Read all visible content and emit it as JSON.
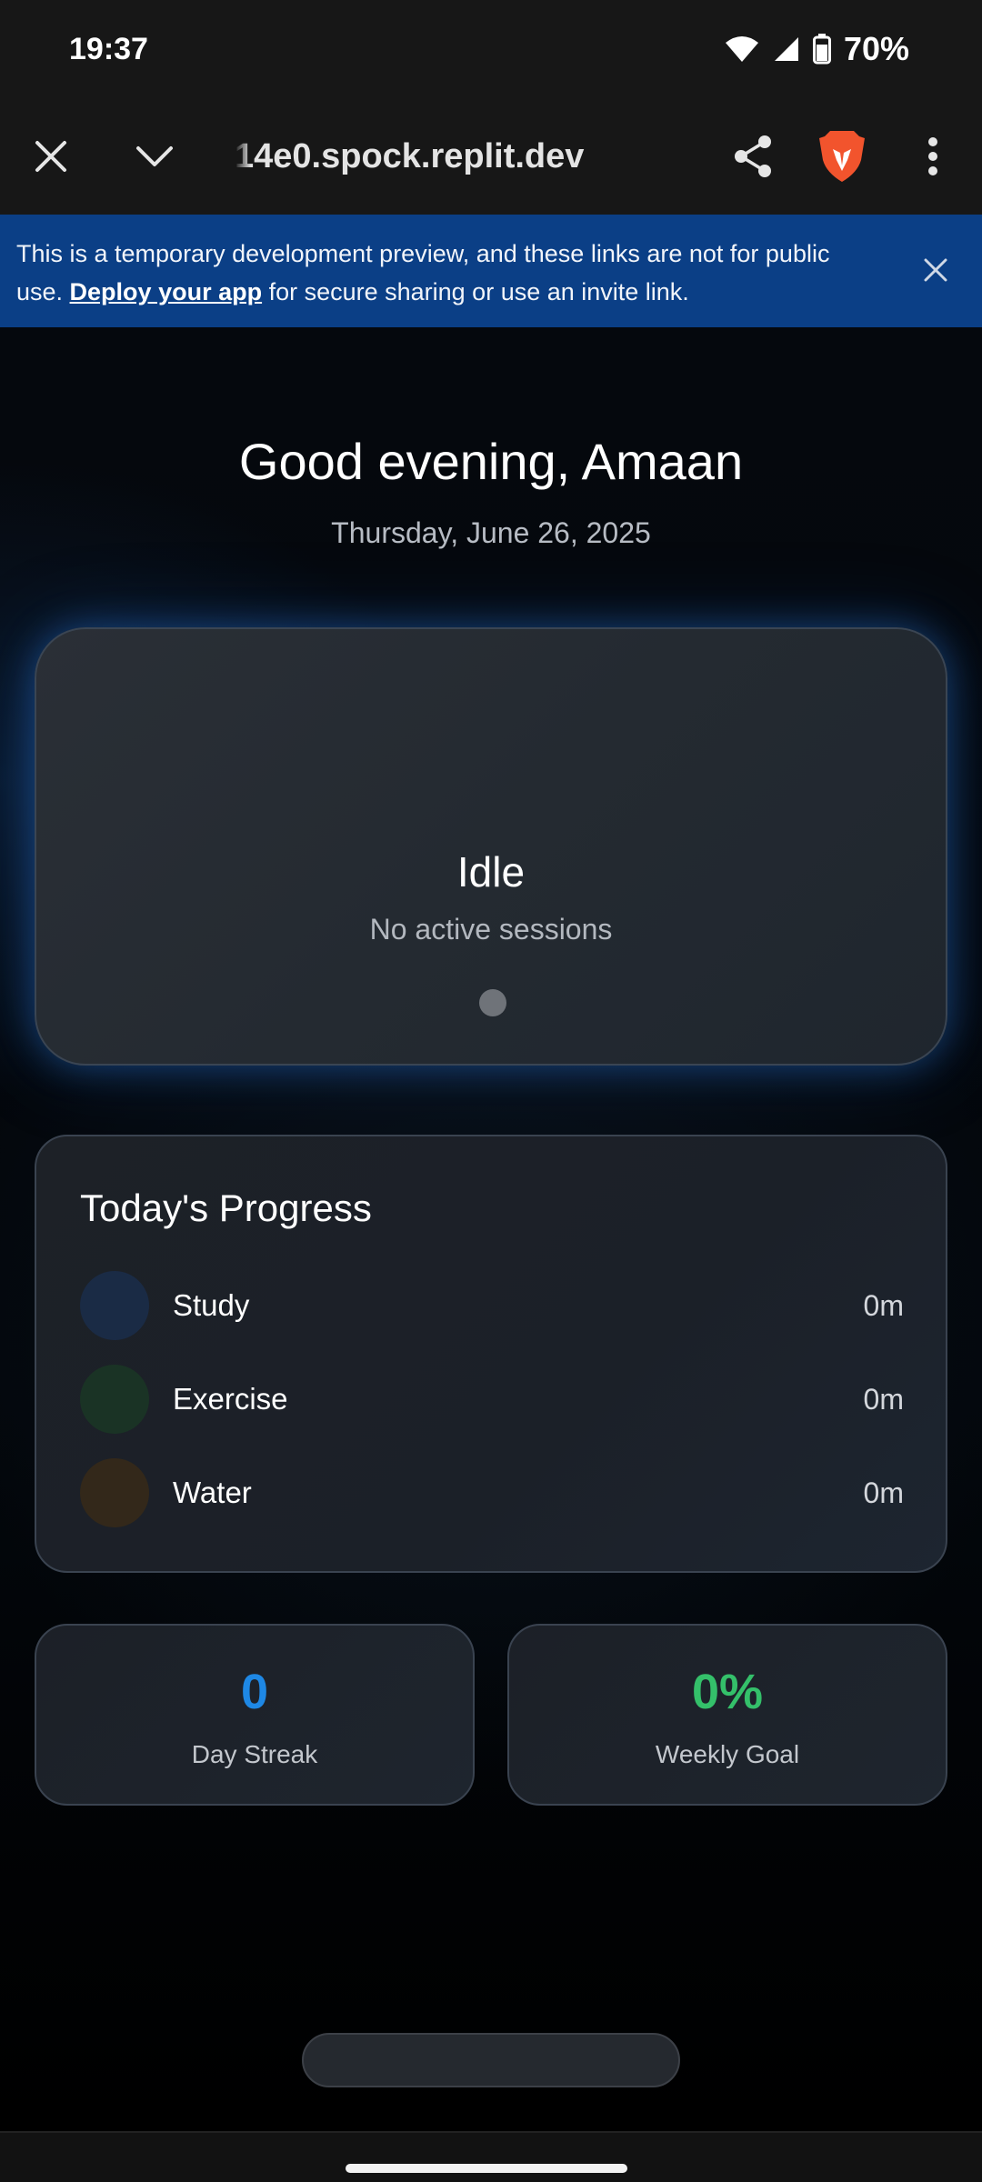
{
  "status_bar": {
    "time": "19:37",
    "battery": "70%",
    "icons": [
      "wifi-icon",
      "cell-signal-icon",
      "battery-icon"
    ]
  },
  "browser": {
    "url": "14e0.spock.replit.dev",
    "icons": [
      "close-icon",
      "chevron-down-icon",
      "share-icon",
      "brave-lion-icon",
      "more-vert-icon"
    ]
  },
  "banner": {
    "text_before": "This is a temporary development preview, and these links are not for public use. ",
    "link_text": "Deploy your app",
    "text_after": " for secure sharing or use an invite link.",
    "color": "#0b3f86"
  },
  "app": {
    "greeting": "Good evening, Amaan",
    "date": "Thursday, June 26, 2025",
    "status": {
      "title": "Idle",
      "subtitle": "No active sessions"
    },
    "progress": {
      "title": "Today's Progress",
      "items": [
        {
          "label": "Study",
          "value": "0m",
          "color": "#1a2b45"
        },
        {
          "label": "Exercise",
          "value": "0m",
          "color": "#1a3325"
        },
        {
          "label": "Water",
          "value": "0m",
          "color": "#33281a"
        }
      ]
    },
    "stats": [
      {
        "value": "0",
        "label": "Day Streak",
        "color": "#1e88e5"
      },
      {
        "value": "0%",
        "label": "Weekly Goal",
        "color": "#34c06a"
      }
    ]
  }
}
